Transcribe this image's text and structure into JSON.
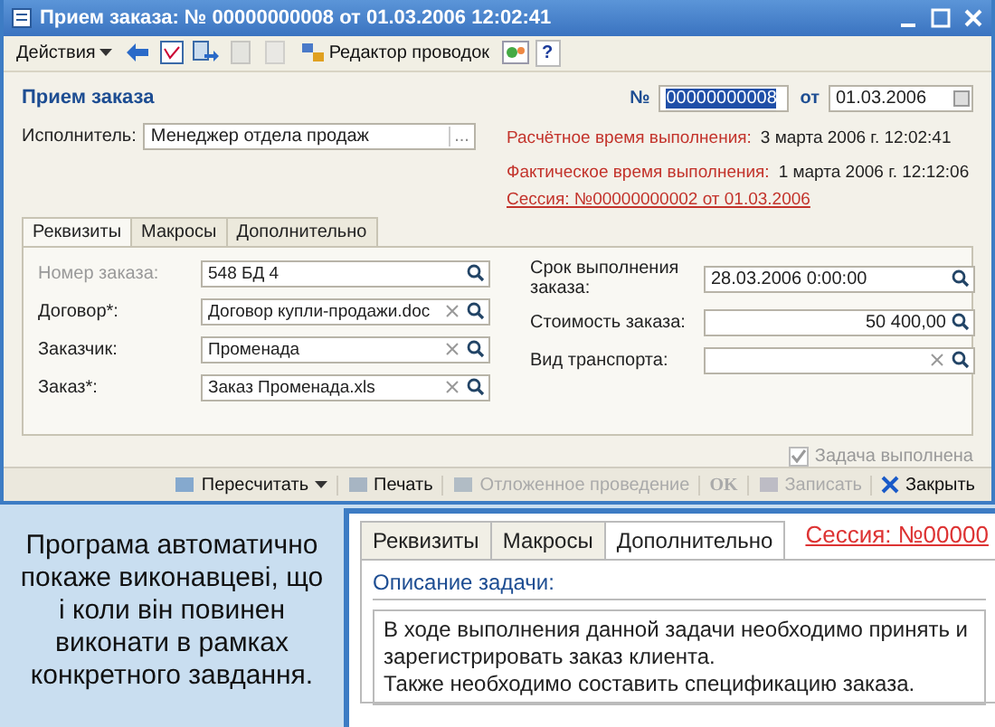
{
  "window": {
    "title": "Прием заказа: № 00000000008 от 01.03.2006 12:02:41"
  },
  "toolbar": {
    "actions": "Действия",
    "editor": "Редактор проводок",
    "help": "?"
  },
  "header": {
    "title": "Прием заказа",
    "number_label": "№",
    "number": "00000000008",
    "date_label": "от",
    "date": "01.03.2006"
  },
  "executor": {
    "label": "Исполнитель:",
    "value": "Менеджер отдела продаж",
    "button": "..."
  },
  "times": [
    {
      "label": "Расчётное время выполнения:",
      "value": "3 марта 2006 г. 12:02:41"
    },
    {
      "label": "Фактическое время выполнения:",
      "value": "1 марта 2006 г. 12:12:06"
    }
  ],
  "session": "Сессия: №00000000002 от 01.03.2006",
  "tabs": [
    {
      "label": "Реквизиты",
      "selected": true
    },
    {
      "label": "Макросы",
      "selected": false
    },
    {
      "label": "Дополнительно",
      "selected": false
    }
  ],
  "left_fields": [
    {
      "label": "Номер заказа:",
      "value": "548 БД 4",
      "disabled": true,
      "clear": false
    },
    {
      "label": "Договор*:",
      "value": "Договор купли-продажи.doc",
      "disabled": false,
      "clear": true
    },
    {
      "label": "Заказчик:",
      "value": "Променада",
      "disabled": false,
      "clear": true
    },
    {
      "label": "Заказ*:",
      "value": "Заказ Променада.xls",
      "disabled": false,
      "clear": true
    }
  ],
  "right_fields": [
    {
      "label": "Срок выполнения заказа:",
      "value": "28.03.2006  0:00:00",
      "kind": "date",
      "clear": false
    },
    {
      "label": "Стоимость заказа:",
      "value": "50 400,00",
      "kind": "amount",
      "clear": false
    },
    {
      "label": "Вид транспорта:",
      "kind": "reference",
      "clear": true
    }
  ],
  "done": {
    "label": "Задача выполнена",
    "checked": true,
    "disabled": true
  },
  "bottom_buttons": [
    {
      "label": "Пересчитать",
      "kind": "menu",
      "disabled": false
    },
    {
      "label": "Печать",
      "kind": "print",
      "disabled": false
    },
    {
      "label": "Отложенное проведение",
      "kind": "deferred",
      "disabled": true
    },
    {
      "label": "OK",
      "kind": "ok",
      "disabled": true
    },
    {
      "label": "Записать",
      "kind": "save",
      "disabled": true
    },
    {
      "label": "Закрыть",
      "kind": "close",
      "disabled": false
    }
  ],
  "caption": "Програма автоматично покаже виконавцеві, що і коли він повинен виконати в рамках конкретного завдання.",
  "inset": {
    "tabs": [
      {
        "label": "Реквизиты",
        "selected": false
      },
      {
        "label": "Макросы",
        "selected": false
      },
      {
        "label": "Дополнительно",
        "selected": true
      }
    ],
    "session": "Сессия: №00000",
    "section": "Описание задачи:",
    "lines": [
      "В ходе выполнения данной задачи необходимо принять и",
      "зарегистрировать заказ клиента.",
      "Также необходимо составить спецификацию заказа."
    ]
  }
}
